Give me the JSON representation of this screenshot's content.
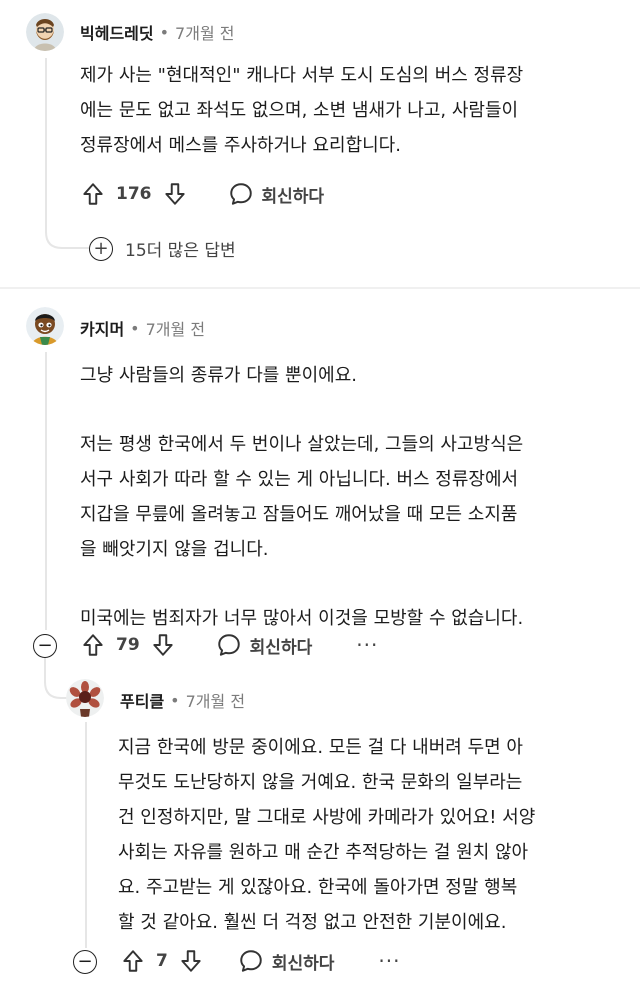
{
  "comments": [
    {
      "username": "빅헤드레딧",
      "time": "7개월 전",
      "lines": [
        "제가 사는 \"현대적인\" 캐나다 서부 도시 도심의 버스 정류장",
        "에는 문도 없고 좌석도 없으며, 소변 냄새가 나고, 사람들이",
        "정류장에서 메스를 주사하거나 요리합니다."
      ],
      "votes": "176",
      "reply_label": "회신하다",
      "more_replies": "15더 많은 답변"
    },
    {
      "username": "카지머",
      "time": "7개월 전",
      "paragraphs": [
        [
          "그냥 사람들의 종류가 다를 뿐이에요."
        ],
        [
          "저는 평생 한국에서 두 번이나 살았는데, 그들의 사고방식은",
          "서구 사회가 따라 할 수 있는 게 아닙니다. 버스 정류장에서",
          "지갑을 무릎에 올려놓고 잠들어도 깨어났을 때 모든 소지품",
          "을 빼앗기지 않을 겁니다."
        ],
        [
          "미국에는 범죄자가 너무 많아서 이것을 모방할 수 없습니다."
        ]
      ],
      "votes": "79",
      "reply_label": "회신하다",
      "more_label": "···",
      "collapse_label": "−"
    },
    {
      "username": "푸티클",
      "time": "7개월 전",
      "lines": [
        "지금 한국에 방문 중이에요. 모든 걸 다 내버려 두면 아",
        "무것도 도난당하지 않을 거예요. 한국 문화의 일부라는",
        "건 인정하지만, 말 그대로 사방에 카메라가 있어요! 서양",
        "사회는 자유를 원하고 매 순간 추적당하는 걸 원치 않아",
        "요. 주고받는 게 있잖아요. 한국에 돌아가면 정말 행복",
        "할 것 같아요. 훨씬 더 걱정 없고 안전한 기분이에요."
      ],
      "votes": "7",
      "reply_label": "회신하다",
      "more_label": "···",
      "collapse_label": "−"
    }
  ],
  "dot": "•",
  "plus": "+"
}
